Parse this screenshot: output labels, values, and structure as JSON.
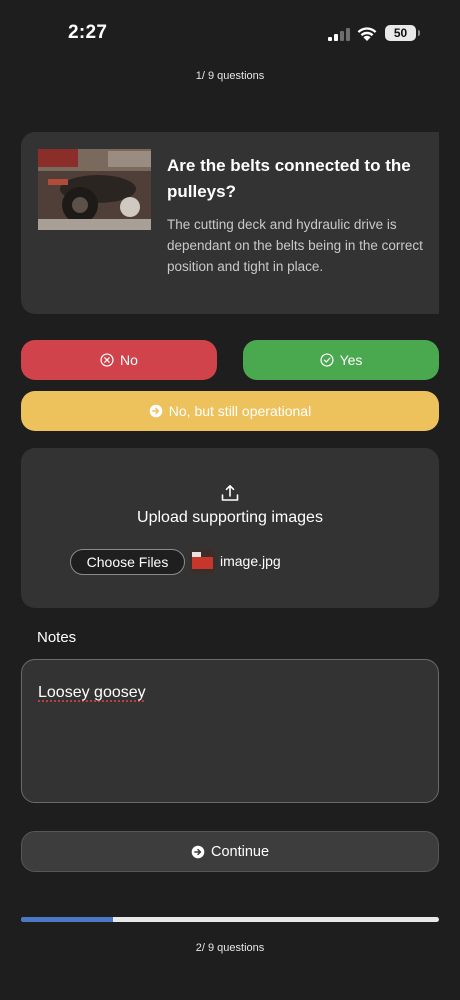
{
  "status_bar": {
    "time": "2:27",
    "battery": "50",
    "signal_icon": "cellular-signal-icon",
    "wifi_icon": "wifi-icon"
  },
  "header": {
    "progress_label": "1/ 9 questions"
  },
  "question": {
    "title": "Are the belts connected to the pulleys?",
    "description": "The cutting deck and hydraulic drive is dependant on the belts being in the correct position and tight in place.",
    "image_icon": "machinery-photo"
  },
  "answers": {
    "no_label": "No",
    "yes_label": "Yes",
    "partial_label": "No, but still operational",
    "colors": {
      "no": "#d0434a",
      "yes": "#4aa84e",
      "partial": "#edc15b"
    }
  },
  "upload": {
    "title": "Upload supporting images",
    "choose_label": "Choose Files",
    "file_name": "image.jpg",
    "icon": "upload-icon"
  },
  "notes": {
    "label": "Notes",
    "value": "Loosey goosey"
  },
  "footer": {
    "continue_label": "Continue",
    "progress_fraction": 0.22,
    "progress_label": "2/ 9 questions",
    "progress_color": "#4a78c4"
  }
}
